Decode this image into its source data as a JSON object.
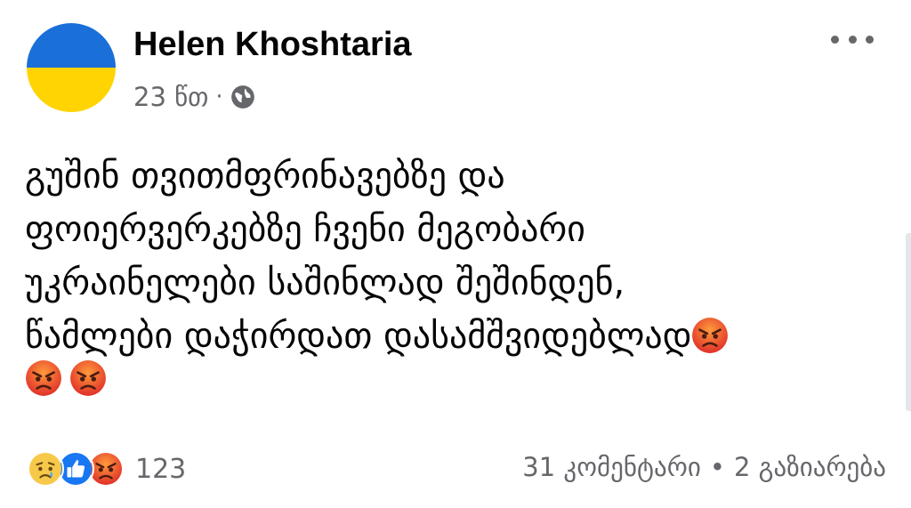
{
  "post": {
    "author": "Helen Khoshtaria",
    "time": "23 წთ",
    "separator": "·",
    "privacy_icon": "globe-icon",
    "more_icon": "more-options-icon",
    "avatar": {
      "type": "ukraine-flag",
      "colors": [
        "#1a6fd8",
        "#ffd400"
      ]
    },
    "text_lines": [
      "გუშინ თვითმფრინავებზე და",
      "ფოიერვერკებზე ჩვენი მეგობარი",
      "უკრაინელები საშინლად შეშინდენ,",
      "წამლები დაჭირდათ დასამშვიდებლად"
    ],
    "emojis": [
      "angry-face",
      "angry-face",
      "angry-face"
    ]
  },
  "footer": {
    "reactions": [
      "sad",
      "like",
      "angry"
    ],
    "reaction_count": "123",
    "comments": "31 კომენტარი",
    "dot": "•",
    "shares": "2 გაზიარება"
  },
  "colors": {
    "text": "#050505",
    "secondary": "#65676b",
    "like_blue": "#1877f2",
    "angry_orange": "#e8603c",
    "sad_yellow": "#f7c94a"
  }
}
